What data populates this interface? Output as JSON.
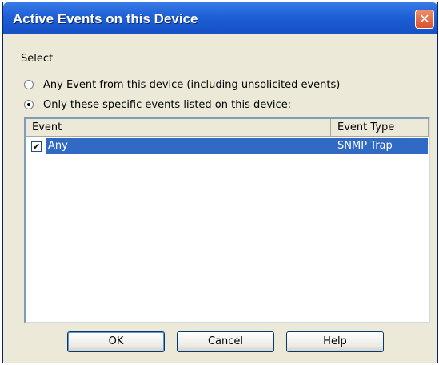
{
  "window": {
    "title": "Active Events on this Device",
    "close_symbol": "✕"
  },
  "select": {
    "label": "Select",
    "options": [
      {
        "accel": "A",
        "rest": "ny Event from this device (including unsolicited events)",
        "checked": false
      },
      {
        "accel": "O",
        "rest": "nly these specific events listed on this device:",
        "checked": true
      }
    ]
  },
  "events_list": {
    "columns": [
      "Event",
      "Event Type"
    ],
    "rows": [
      {
        "checked": true,
        "event": "Any",
        "event_type": "SNMP Trap",
        "selected": true
      }
    ]
  },
  "buttons": {
    "ok": "OK",
    "cancel": "Cancel",
    "help": "Help"
  },
  "icons": {
    "close": "close-icon",
    "checkbox": "checkbox-checked-icon"
  },
  "colors": {
    "title_bar": "#1d5fd6",
    "selection": "#316ac5",
    "dialog_bg": "#ece9d8"
  }
}
